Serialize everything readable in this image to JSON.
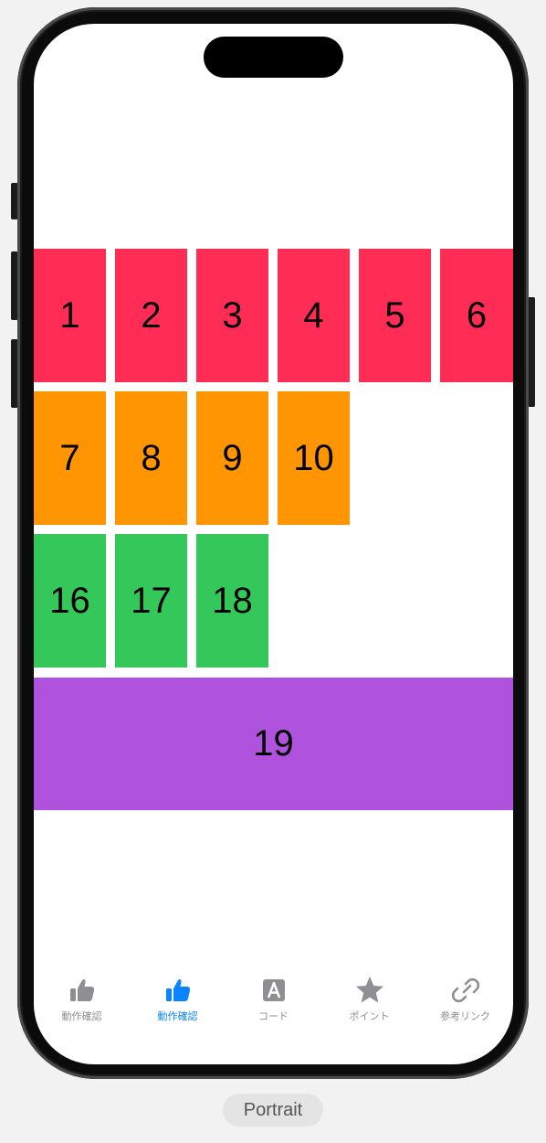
{
  "grid": {
    "row1": [
      "1",
      "2",
      "3",
      "4",
      "5",
      "6"
    ],
    "row2": [
      "7",
      "8",
      "9",
      "10"
    ],
    "row3": [
      "16",
      "17",
      "18"
    ],
    "row4": [
      "19"
    ]
  },
  "colors": {
    "row1": "#ff2d55",
    "row2": "#ff9500",
    "row3": "#34c759",
    "row4": "#af52de",
    "tab_active": "#0a84ff",
    "tab_inactive": "#8e8e93"
  },
  "tabbar": {
    "tabs": [
      {
        "label": "動作確認",
        "icon": "thumbs-up-icon",
        "active": false
      },
      {
        "label": "動作確認",
        "icon": "thumbs-up-icon",
        "active": true
      },
      {
        "label": "コード",
        "icon": "letter-a-square-icon",
        "active": false
      },
      {
        "label": "ポイント",
        "icon": "star-icon",
        "active": false
      },
      {
        "label": "参考リンク",
        "icon": "link-icon",
        "active": false
      }
    ]
  },
  "orientation_label": "Portrait"
}
